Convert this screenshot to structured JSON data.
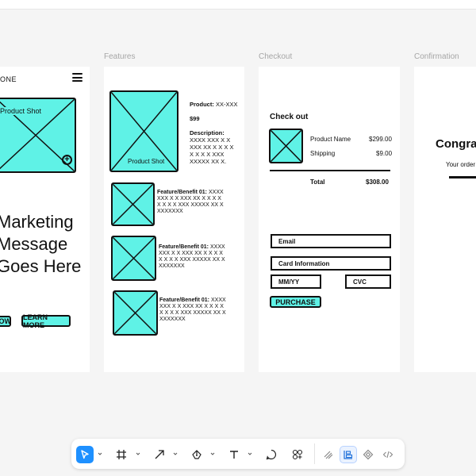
{
  "frames": {
    "home": {
      "logo": "ONE",
      "hero_image_label": "Product Shot",
      "headline": [
        "Marketing",
        "Message",
        "Goes Here"
      ],
      "buttons": [
        "NOW",
        "LEARN MORE"
      ]
    },
    "features": {
      "label": "Features",
      "image_label": "Product Shot",
      "product_label": "Product:",
      "product_value": "XX-XXX",
      "price": "$99",
      "description_label": "Description:",
      "description_text": "XXXX XXX X X XXX XX X X X X X X X X XXX XXXXX XX X.",
      "benefits": [
        {
          "label": "Feature/Benefit 01:",
          "text": "XXXX XXX X X XXX XX X X X X X X X X XXX XXXXX XX X XXXXXXX"
        },
        {
          "label": "Feature/Benefit 01:",
          "text": "XXXX XXX X X XXX XX X X X X X X X X XXX XXXXX XX X XXXXXXX"
        },
        {
          "label": "Feature/Benefit 01:",
          "text": "XXXX XXX X X XXX XX X X X X X X X X XXX XXXXX XX X XXXXXXX"
        }
      ]
    },
    "checkout": {
      "label": "Checkout",
      "title": "Check out",
      "product_name": "Product Name",
      "product_price": "$299.00",
      "shipping": "Shipping",
      "shipping_price": "$9.00",
      "total_label": "Total",
      "total_value": "$308.00",
      "email": "Email",
      "card": "Card Information",
      "mmyy": "MM/YY",
      "cvc": "CVC",
      "purchase": "PURCHASE"
    },
    "confirmation": {
      "label": "Confirmation",
      "heading": "Congra",
      "text": "Your order"
    }
  },
  "toolbar": {
    "tools": [
      "move-tool",
      "frame-tool",
      "arrow-tool",
      "pen-tool",
      "text-tool",
      "comment-tool",
      "components-tool",
      "draw-tool",
      "layout-tool",
      "prototype-tool",
      "code-tool"
    ],
    "accent": "#1e90ff"
  },
  "colors": {
    "placeholder": "#5ff2e6",
    "canvas": "#f5f5f5"
  }
}
